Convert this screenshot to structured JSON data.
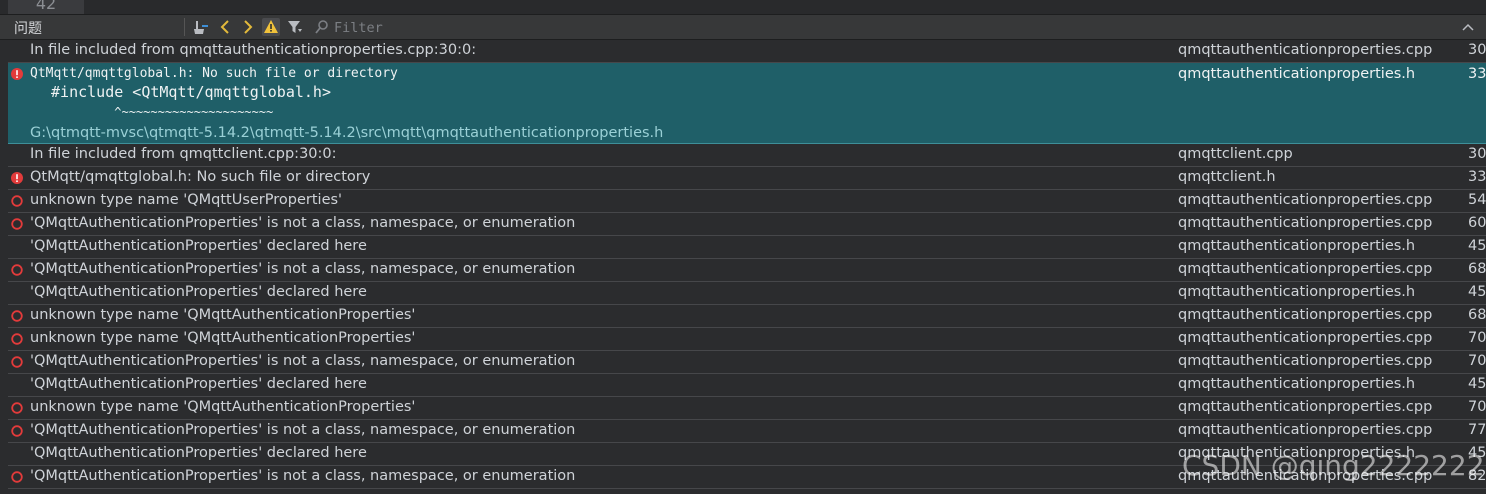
{
  "editor": {
    "line_number": "42"
  },
  "toolbar": {
    "title": "问题",
    "filter_placeholder": "Filter",
    "icons": [
      "clean-icon",
      "prev-icon",
      "next-icon",
      "warning-filter-icon",
      "filter-icon",
      "search-icon",
      "collapse-icon"
    ]
  },
  "colors": {
    "error_red": "#e23b3b",
    "selected_bg": "#1f5f68",
    "nav_arrow": "#e2b93b",
    "warning_yellow": "#f0c23b"
  },
  "issues": [
    {
      "type": "note",
      "message": "In file included from qmqttauthenticationproperties.cpp:30:0:",
      "file": "qmqttauthenticationproperties.cpp",
      "line": "30"
    },
    {
      "type": "error",
      "message": "QtMqtt/qmqttglobal.h: No such file or directory",
      "code_line": " #include <QtMqtt/qmqttglobal.h>",
      "caret_line": "          ^~~~~~~~~~~~~~~~~~~~~~",
      "path": "G:\\qtmqtt-mvsc\\qtmqtt-5.14.2\\qtmqtt-5.14.2\\src\\mqtt\\qmqttauthenticationproperties.h",
      "file": "qmqttauthenticationproperties.h",
      "line": "33"
    },
    {
      "type": "note",
      "message": "In file included from qmqttclient.cpp:30:0:",
      "file": "qmqttclient.cpp",
      "line": "30"
    },
    {
      "type": "error",
      "message": "QtMqtt/qmqttglobal.h: No such file or directory",
      "file": "qmqttclient.h",
      "line": "33"
    },
    {
      "type": "error-outline",
      "message": "unknown type name 'QMqttUserProperties'",
      "file": "qmqttauthenticationproperties.cpp",
      "line": "54"
    },
    {
      "type": "error-outline",
      "message": "'QMqttAuthenticationProperties' is not a class, namespace, or enumeration",
      "file": "qmqttauthenticationproperties.cpp",
      "line": "60"
    },
    {
      "type": "note",
      "message": "'QMqttAuthenticationProperties' declared here",
      "file": "qmqttauthenticationproperties.h",
      "line": "45"
    },
    {
      "type": "error-outline",
      "message": "'QMqttAuthenticationProperties' is not a class, namespace, or enumeration",
      "file": "qmqttauthenticationproperties.cpp",
      "line": "68"
    },
    {
      "type": "note",
      "message": "'QMqttAuthenticationProperties' declared here",
      "file": "qmqttauthenticationproperties.h",
      "line": "45"
    },
    {
      "type": "error-outline",
      "message": "unknown type name 'QMqttAuthenticationProperties'",
      "file": "qmqttauthenticationproperties.cpp",
      "line": "68"
    },
    {
      "type": "error-outline",
      "message": "unknown type name 'QMqttAuthenticationProperties'",
      "file": "qmqttauthenticationproperties.cpp",
      "line": "70"
    },
    {
      "type": "error-outline",
      "message": "'QMqttAuthenticationProperties' is not a class, namespace, or enumeration",
      "file": "qmqttauthenticationproperties.cpp",
      "line": "70"
    },
    {
      "type": "note",
      "message": "'QMqttAuthenticationProperties' declared here",
      "file": "qmqttauthenticationproperties.h",
      "line": "45"
    },
    {
      "type": "error-outline",
      "message": "unknown type name 'QMqttAuthenticationProperties'",
      "file": "qmqttauthenticationproperties.cpp",
      "line": "70"
    },
    {
      "type": "error-outline",
      "message": "'QMqttAuthenticationProperties' is not a class, namespace, or enumeration",
      "file": "qmqttauthenticationproperties.cpp",
      "line": "77"
    },
    {
      "type": "note",
      "message": "'QMqttAuthenticationProperties' declared here",
      "file": "qmqttauthenticationproperties.h",
      "line": "45"
    },
    {
      "type": "error-outline",
      "message": "'QMqttAuthenticationProperties' is not a class, namespace, or enumeration",
      "file": "qmqttauthenticationproperties.cpp",
      "line": "82"
    }
  ],
  "watermark": "CSDN @qing222222222"
}
